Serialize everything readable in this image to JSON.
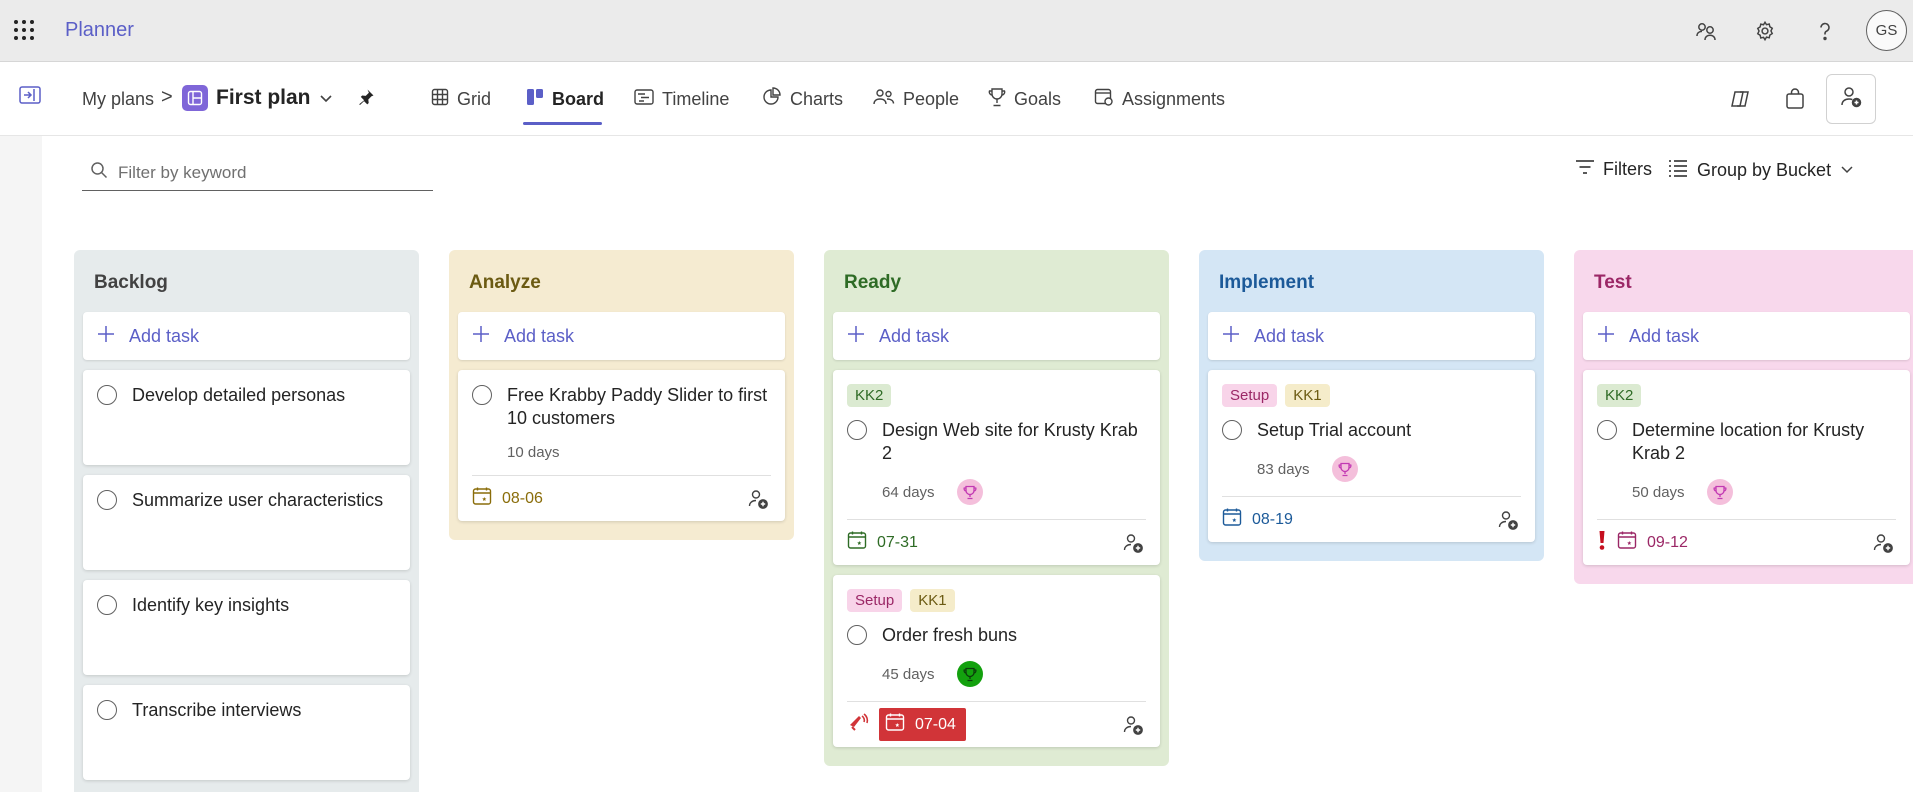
{
  "app": {
    "title": "Planner"
  },
  "topbar": {
    "icons": [
      "chat-icon",
      "gear-icon",
      "help-icon"
    ],
    "avatar_initials": "GS"
  },
  "nav": {
    "breadcrumb_root": "My plans",
    "separator": ">",
    "plan_name": "First plan",
    "tabs": [
      {
        "label": "Grid",
        "icon": "grid-icon",
        "active": false
      },
      {
        "label": "Board",
        "icon": "board-icon",
        "active": true
      },
      {
        "label": "Timeline",
        "icon": "timeline-icon",
        "active": false
      },
      {
        "label": "Charts",
        "icon": "charts-icon",
        "active": false
      },
      {
        "label": "People",
        "icon": "people-icon",
        "active": false
      },
      {
        "label": "Goals",
        "icon": "trophy-icon",
        "active": false
      },
      {
        "label": "Assignments",
        "icon": "assignments-icon",
        "active": false
      }
    ]
  },
  "filter": {
    "placeholder": "Filter by keyword",
    "filters_label": "Filters",
    "group_by_label": "Group by Bucket"
  },
  "accent_color": "#5b5fc7",
  "add_task_label": "Add task",
  "buckets": [
    {
      "name": "Backlog",
      "bg": "#e6ebec",
      "title_color": "#424242",
      "tasks": [
        {
          "title": "Develop detailed personas"
        },
        {
          "title": "Summarize user characteristics"
        },
        {
          "title": "Identify key insights"
        },
        {
          "title": "Transcribe interviews"
        }
      ]
    },
    {
      "name": "Analyze",
      "bg": "#f5ebd1",
      "title_color": "#6b5a12",
      "tasks": [
        {
          "title": "Free Krabby Paddy Slider to first 10 customers",
          "duration": "10 days",
          "due": "08-06",
          "due_color": "#8a6d0a"
        }
      ]
    },
    {
      "name": "Ready",
      "bg": "#dfebd3",
      "title_color": "#2e6b25",
      "tasks": [
        {
          "labels": [
            "KK2"
          ],
          "title": "Design Web site for Krusty Krab 2",
          "duration": "64 days",
          "goal_color": "pink",
          "due": "07-31",
          "due_color": "#2e6b25"
        },
        {
          "labels": [
            "Setup",
            "KK1"
          ],
          "title": "Order fresh buns",
          "duration": "45 days",
          "goal_color": "green",
          "due": "07-04",
          "overdue": true
        }
      ]
    },
    {
      "name": "Implement",
      "bg": "#d4e6f5",
      "title_color": "#1c5a99",
      "tasks": [
        {
          "labels": [
            "Setup",
            "KK1"
          ],
          "title": "Setup Trial account",
          "duration": "83 days",
          "goal_color": "pink",
          "due": "08-19",
          "due_color": "#1c5a99"
        }
      ]
    },
    {
      "name": "Test",
      "bg": "#f8d8ec",
      "title_color": "#9b2766",
      "tasks": [
        {
          "labels": [
            "KK2"
          ],
          "title": "Determine location for Krusty Krab 2",
          "duration": "50 days",
          "goal_color": "pink",
          "due": "09-12",
          "due_color": "#9b2766",
          "important": true
        }
      ]
    }
  ]
}
